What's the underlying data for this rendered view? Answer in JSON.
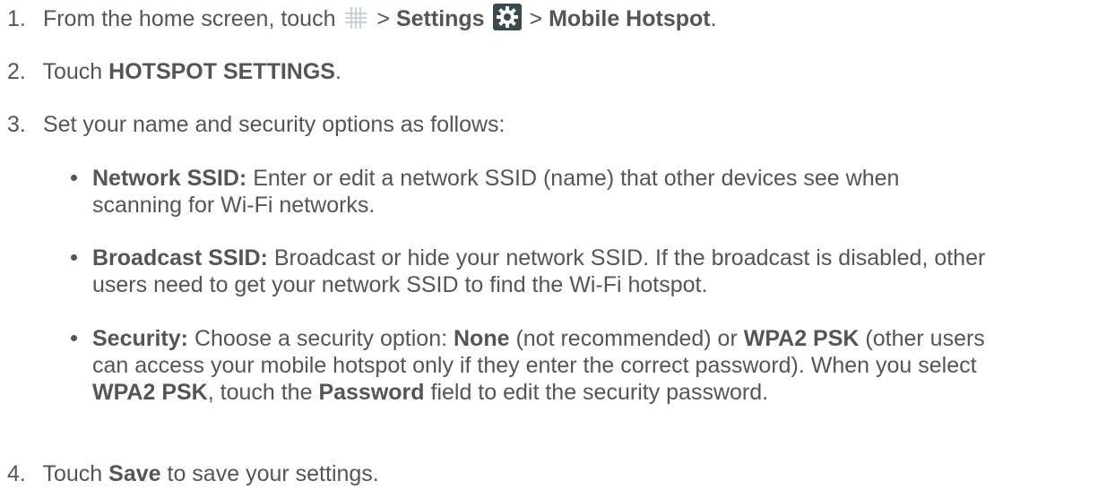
{
  "steps": [
    {
      "num": "1.",
      "prefix": "From the home screen, touch",
      "sep1": ">",
      "settings": "Settings",
      "sep2": ">",
      "mobile_hotspot": "Mobile Hotspot",
      "end": "."
    },
    {
      "num": "2.",
      "prefix": "Touch",
      "bold": "HOTSPOT SETTINGS",
      "end": "."
    },
    {
      "num": "3.",
      "text": "Set your name and security options as follows:"
    },
    {
      "num": "4.",
      "prefix": "Touch",
      "bold": "Save",
      "suffix": "to save your settings."
    }
  ],
  "bullets": [
    {
      "term": "Network SSID:",
      "line1": "Enter or edit a network SSID (name) that other devices see when",
      "line2": "scanning for Wi-Fi networks."
    },
    {
      "term": "Broadcast SSID:",
      "line1": "Broadcast or hide your network SSID. If the broadcast is disabled, other",
      "line2": "users need to get your network SSID to find the Wi-Fi hotspot."
    },
    {
      "term": "Security:",
      "a": "Choose a security option:",
      "none": "None",
      "b": "(not recommended) or",
      "wpa": "WPA2 PSK",
      "c": "(other users",
      "line2": "can access your mobile hotspot only if they enter the correct password). When you select",
      "wpa2": "WPA2 PSK",
      "d": ", touch the",
      "password": "Password",
      "e": "field to edit the security password."
    }
  ],
  "icons": {
    "apps": "apps-grid-icon",
    "settings": "settings-gear-icon",
    "settings_bg": "#3a4a4f"
  }
}
